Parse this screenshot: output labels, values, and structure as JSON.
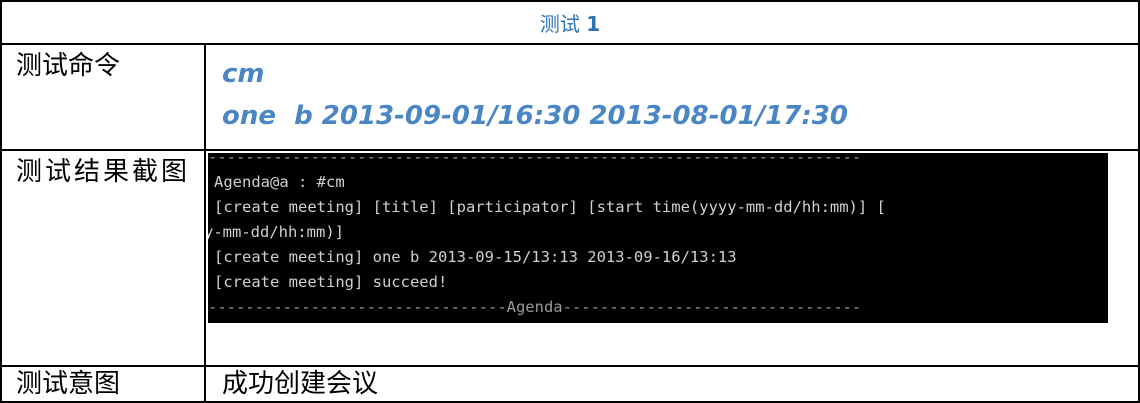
{
  "title": {
    "text": "测试",
    "number": "1"
  },
  "rows": {
    "command": {
      "label": "测试命令",
      "lines": [
        "cm",
        "one  b 2013-09-01/16:30 2013-08-01/17:30"
      ]
    },
    "result": {
      "label": "测试结果截图",
      "terminal": {
        "lines": [
          "----------------------------------------------------------------------",
          "Agenda@a : #cm",
          "[create meeting] [title] [participator] [start time(yyyy-mm-dd/hh:mm)] [",
          "y-mm-dd/hh:mm)]",
          "[create meeting] one b 2013-09-15/13:13 2013-09-16/13:13",
          "[create meeting] succeed!",
          "--------------------------------Agenda--------------------------------"
        ]
      }
    },
    "intent": {
      "label": "测试意图",
      "value": "成功创建会议"
    }
  }
}
